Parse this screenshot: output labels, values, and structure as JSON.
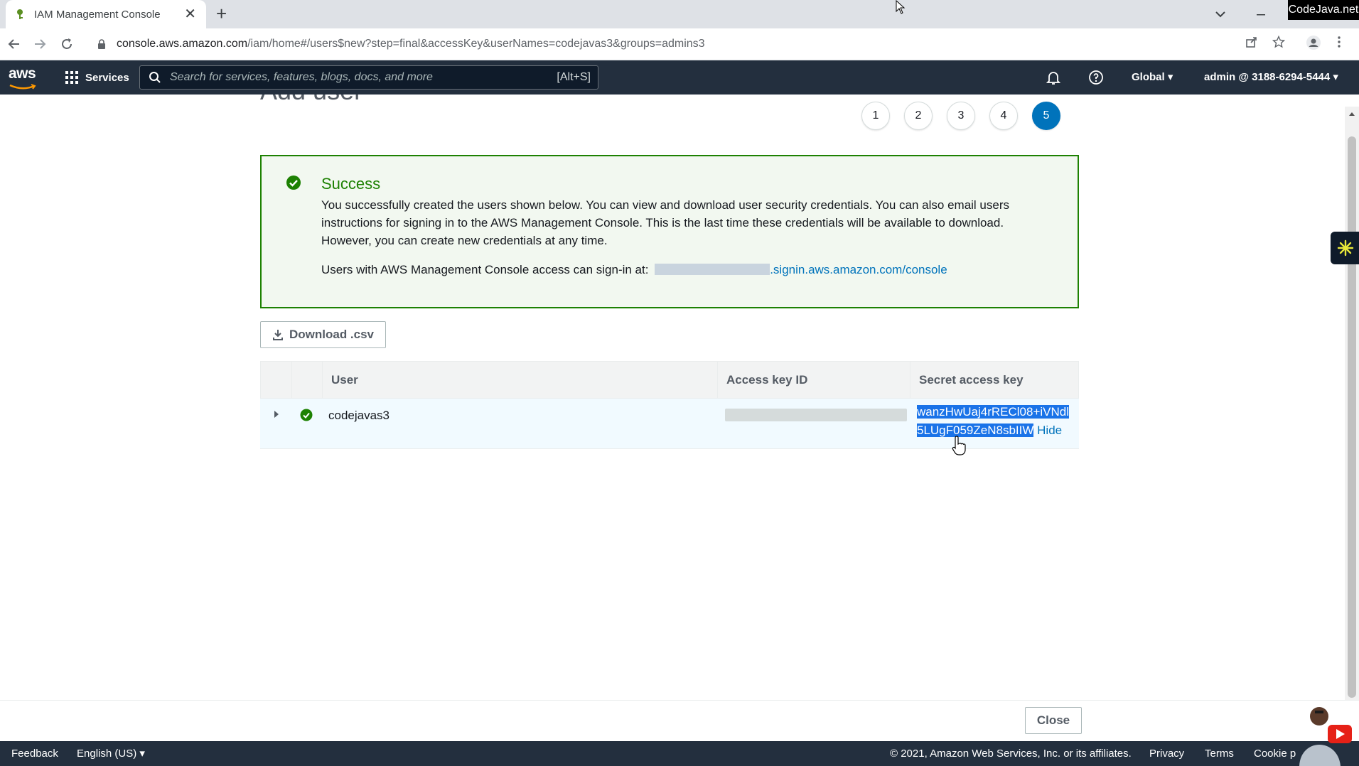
{
  "browser": {
    "tab_title": "IAM Management Console",
    "tab_close": "✕",
    "new_tab": "+",
    "url_host": "console.aws.amazon.com",
    "url_path": "/iam/home#/users$new?step=final&accessKey&userNames=codejavas3&groups=admins3",
    "watermark": "CodeJava.net"
  },
  "aws_nav": {
    "services_label": "Services",
    "search_placeholder": "Search for services, features, blogs, docs, and more",
    "search_shortcut": "[Alt+S]",
    "region_label": "Global ▾",
    "account_label": "admin @ 3188-6294-5444 ▾"
  },
  "page": {
    "title": "Add user",
    "steps": [
      "1",
      "2",
      "3",
      "4",
      "5"
    ],
    "active_step": "5"
  },
  "success": {
    "title": "Success",
    "message": "You successfully created the users shown below. You can view and download user security credentials. You can also email users instructions for signing in to the AWS Management Console. This is the last time these credentials will be available to download. However, you can create new credentials at any time.",
    "signin_prefix": "Users with AWS Management Console access can sign-in at:",
    "signin_link": ".signin.aws.amazon.com/console"
  },
  "download_label": "Download .csv",
  "table": {
    "columns": [
      "User",
      "Access key ID",
      "Secret access key"
    ],
    "rows": [
      {
        "user": "codejavas3",
        "secret_line1": "wanzHwUaj4rRECl08+iVNdl",
        "secret_line2": "5LUgF059ZeN8sbIIW",
        "hide_label": "Hide"
      }
    ]
  },
  "close_label": "Close",
  "footer": {
    "feedback": "Feedback",
    "language": "English (US) ▾",
    "copyright": "© 2021, Amazon Web Services, Inc. or its affiliates.",
    "privacy": "Privacy",
    "terms": "Terms",
    "cookie": "Cookie p"
  },
  "colors": {
    "nav_bg": "#232f3e",
    "success_green": "#1d8102",
    "link_blue": "#0073bb",
    "selection_blue": "#1a73e8"
  },
  "icons": [
    "favicon-key-icon",
    "back-icon",
    "forward-icon",
    "reload-icon",
    "lock-icon",
    "share-icon",
    "star-icon",
    "profile-icon",
    "menu-icon",
    "grid-icon",
    "search-icon",
    "bell-icon",
    "help-icon",
    "check-circle-icon",
    "download-icon",
    "expand-icon"
  ]
}
